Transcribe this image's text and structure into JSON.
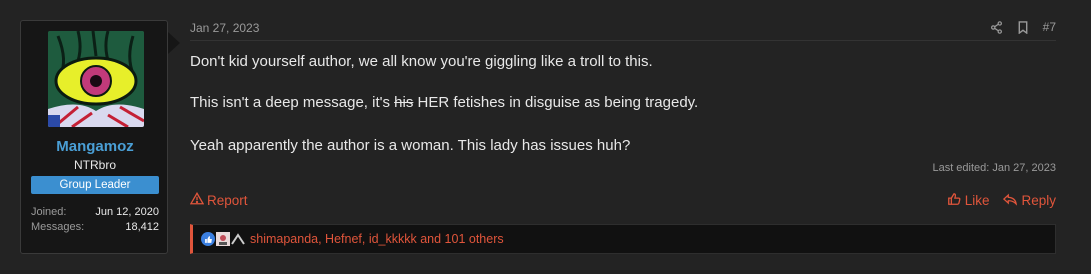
{
  "user": {
    "name": "Mangamoz",
    "title": "NTRbro",
    "banner": "Group Leader",
    "stats": [
      {
        "label": "Joined:",
        "value": "Jun 12, 2020"
      },
      {
        "label": "Messages:",
        "value": "18,412"
      }
    ]
  },
  "post": {
    "date": "Jan 27, 2023",
    "number": "#7",
    "lines": {
      "line1": "Don't kid yourself author, we all know you're giggling like a troll to this.",
      "line2_pre": "This isn't a deep message, it's ",
      "line2_struck": "his",
      "line2_post": " HER fetishes in disguise as being tragedy.",
      "line3": "Yeah apparently the author is a woman. This lady has issues huh?"
    },
    "last_edited": "Last edited: Jan 27, 2023"
  },
  "actions": {
    "report": "Report",
    "like": "Like",
    "reply": "Reply"
  },
  "reactions": {
    "text": "shimapanda, Hefnef, id_kkkkk and 101 others"
  },
  "icons": {
    "share": "share-icon",
    "bookmark": "bookmark-icon",
    "warning": "warning-icon",
    "thumbs_up": "thumbs-up-icon",
    "reply": "reply-icon"
  },
  "colors": {
    "accent": "#e0553b",
    "username": "#4a9fd6",
    "banner": "#3b8fd0"
  }
}
